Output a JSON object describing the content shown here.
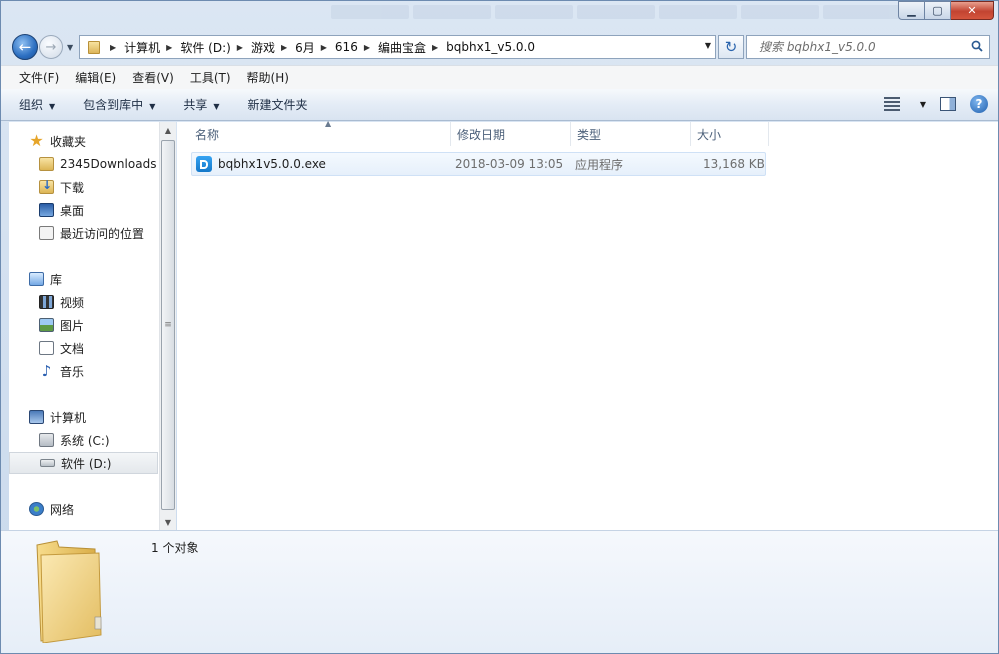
{
  "address": {
    "crumbs": [
      "计算机",
      "软件 (D:)",
      "游戏",
      "6月",
      "616",
      "编曲宝盒",
      "bqbhx1_v5.0.0"
    ]
  },
  "search": {
    "placeholder": "搜索 bqbhx1_v5.0.0"
  },
  "menu": [
    "文件(F)",
    "编辑(E)",
    "查看(V)",
    "工具(T)",
    "帮助(H)"
  ],
  "commands": {
    "organize": "组织",
    "include_library": "包含到库中",
    "share": "共享",
    "new_folder": "新建文件夹"
  },
  "sidebar": {
    "favorites": {
      "label": "收藏夹",
      "items": [
        "2345Downloads",
        "下载",
        "桌面",
        "最近访问的位置"
      ]
    },
    "libraries": {
      "label": "库",
      "items": [
        "视频",
        "图片",
        "文档",
        "音乐"
      ]
    },
    "computer": {
      "label": "计算机",
      "items": [
        "系统 (C:)",
        "软件 (D:)"
      ]
    },
    "network": {
      "label": "网络"
    }
  },
  "columns": {
    "name": "名称",
    "modified": "修改日期",
    "type": "类型",
    "size": "大小"
  },
  "files": [
    {
      "name": "bqbhx1v5.0.0.exe",
      "modified": "2018-03-09 13:05",
      "type": "应用程序",
      "size": "13,168 KB"
    }
  ],
  "details": {
    "count": "1 个对象"
  },
  "colors": {
    "accent": "#2c6fc1",
    "selection": "#e6f0fb",
    "folder": "#f2d27a"
  }
}
